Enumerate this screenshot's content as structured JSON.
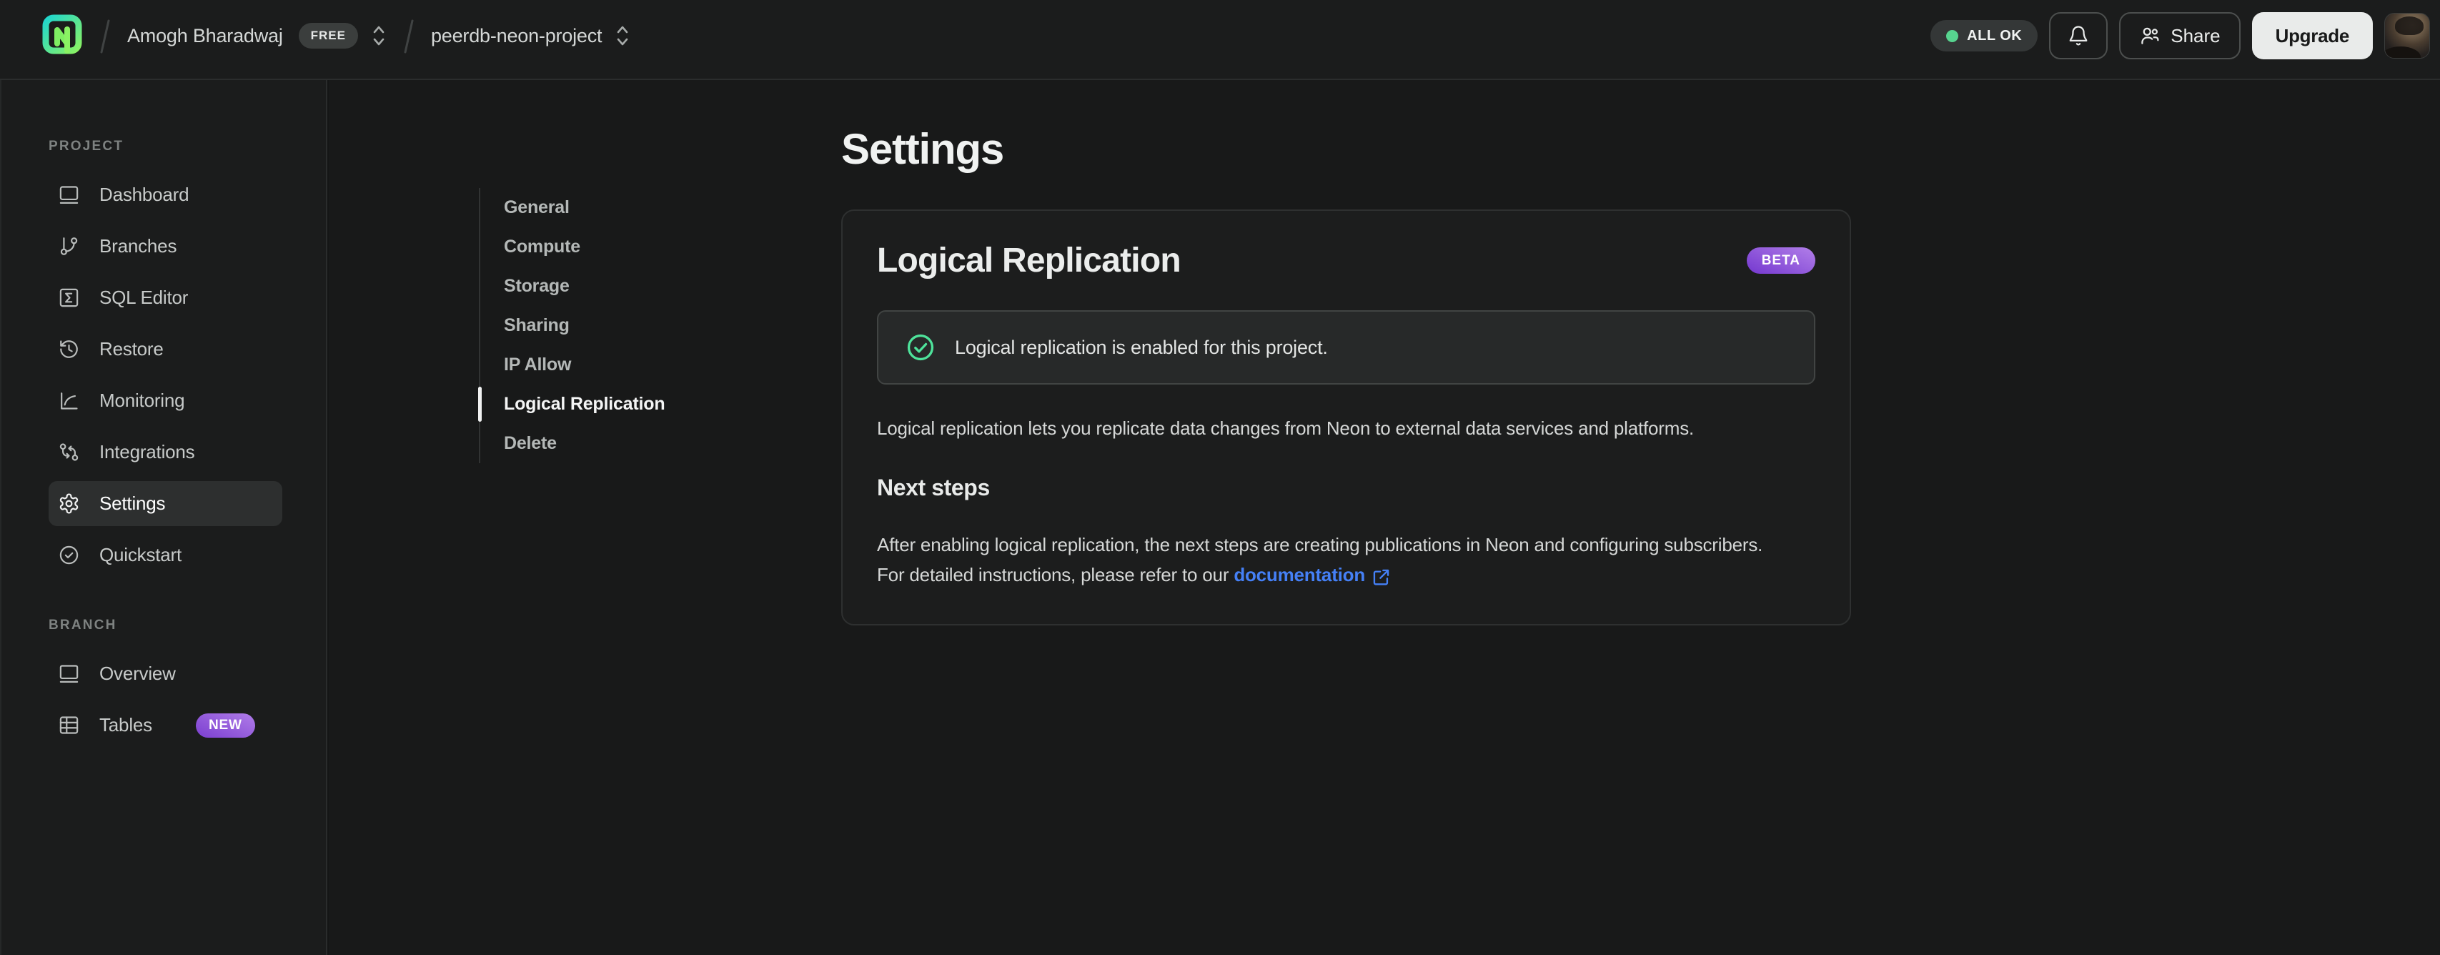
{
  "topbar": {
    "org_name": "Amogh Bharadwaj",
    "org_plan_badge": "FREE",
    "project_name": "peerdb-neon-project",
    "status_badge": "ALL OK",
    "share_label": "Share",
    "upgrade_label": "Upgrade"
  },
  "sidebar": {
    "sections": [
      {
        "label": "PROJECT",
        "items": [
          {
            "label": "Dashboard"
          },
          {
            "label": "Branches"
          },
          {
            "label": "SQL Editor"
          },
          {
            "label": "Restore"
          },
          {
            "label": "Monitoring"
          },
          {
            "label": "Integrations"
          },
          {
            "label": "Settings"
          },
          {
            "label": "Quickstart"
          }
        ]
      },
      {
        "label": "BRANCH",
        "items": [
          {
            "label": "Overview"
          },
          {
            "label": "Tables",
            "badge": "NEW"
          }
        ]
      }
    ],
    "active_item": "Settings"
  },
  "settings_nav": {
    "items": [
      {
        "label": "General"
      },
      {
        "label": "Compute"
      },
      {
        "label": "Storage"
      },
      {
        "label": "Sharing"
      },
      {
        "label": "IP Allow"
      },
      {
        "label": "Logical Replication"
      },
      {
        "label": "Delete"
      }
    ],
    "active_item": "Logical Replication"
  },
  "main": {
    "page_title": "Settings",
    "card": {
      "title": "Logical Replication",
      "beta_badge": "BETA",
      "alert_text": "Logical replication is enabled for this project.",
      "description": "Logical replication lets you replicate data changes from Neon to external data services and platforms.",
      "next_steps_title": "Next steps",
      "next_steps_text": "After enabling logical replication, the next steps are creating publications in Neon and configuring subscribers. For detailed instructions, please refer to our ",
      "doc_link_label": "documentation"
    }
  },
  "colors": {
    "accent_green": "#4ee39b",
    "status_dot_green": "#57d48f",
    "badge_purple_start": "#b27fe9",
    "badge_purple_end": "#7438cf",
    "link_blue": "#4580f6",
    "logo_gradient_start": "#1fd6cd",
    "logo_gradient_end": "#8af263"
  }
}
